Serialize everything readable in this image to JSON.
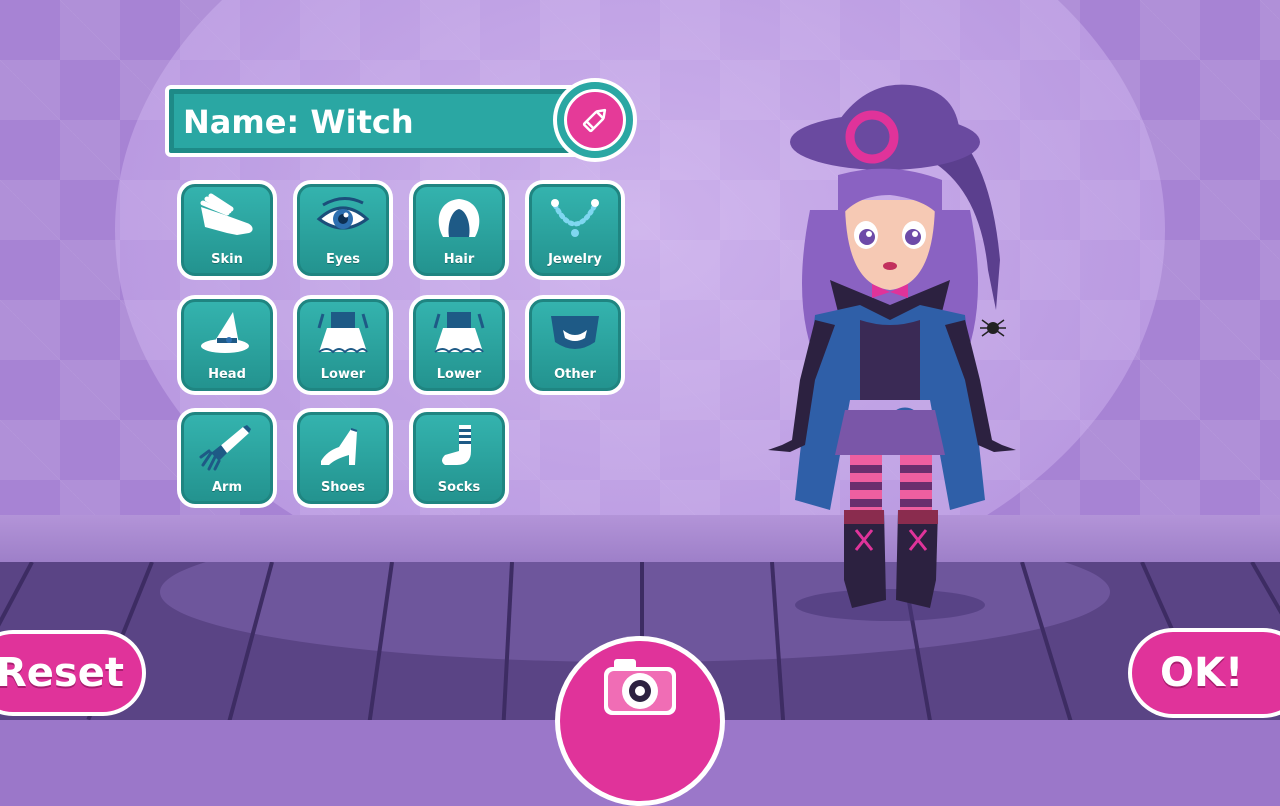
{
  "name_panel": {
    "text": "Name: Witch"
  },
  "categories": [
    {
      "label": "Skin",
      "icon": "hand-icon"
    },
    {
      "label": "Eyes",
      "icon": "eye-icon"
    },
    {
      "label": "Hair",
      "icon": "hair-icon"
    },
    {
      "label": "Jewelry",
      "icon": "necklace-icon"
    },
    {
      "label": "Head",
      "icon": "witch-hat-icon"
    },
    {
      "label": "Lower",
      "icon": "skirt-icon"
    },
    {
      "label": "Lower",
      "icon": "skirt-icon"
    },
    {
      "label": "Other",
      "icon": "collar-icon"
    },
    {
      "label": "Arm",
      "icon": "glove-icon"
    },
    {
      "label": "Shoes",
      "icon": "high-heel-icon"
    },
    {
      "label": "Socks",
      "icon": "sock-icon"
    }
  ],
  "buttons": {
    "reset": "Reset",
    "ok": "OK!"
  },
  "colors": {
    "teal": "#2aa7a3",
    "pink": "#e0339a",
    "purple_bg": "#a783d4"
  }
}
